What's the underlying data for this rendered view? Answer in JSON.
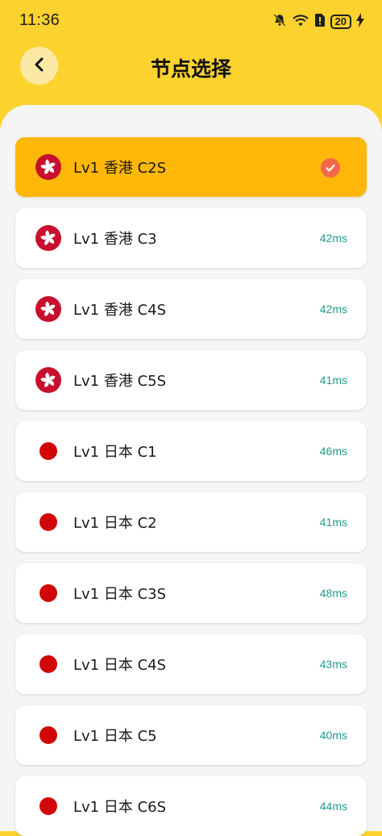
{
  "status_bar": {
    "time": "11:36",
    "battery": "20",
    "icons": [
      "bell-off-icon",
      "wifi-icon",
      "sim-alert-icon",
      "battery-icon",
      "charging-icon"
    ]
  },
  "header": {
    "title": "节点选择",
    "back_icon": "chevron-left-icon"
  },
  "colors": {
    "background": "#FCD22E",
    "selected_card": "#FFB70A",
    "latency_text": "#1E9C8C",
    "check_badge": "#F4684A"
  },
  "nodes": [
    {
      "name": "Lv1 香港 C2S",
      "flag": "hong-kong-flag-icon",
      "latency": "",
      "selected": true
    },
    {
      "name": "Lv1 香港 C3",
      "flag": "hong-kong-flag-icon",
      "latency": "42ms",
      "selected": false
    },
    {
      "name": "Lv1 香港 C4S",
      "flag": "hong-kong-flag-icon",
      "latency": "42ms",
      "selected": false
    },
    {
      "name": "Lv1 香港 C5S",
      "flag": "hong-kong-flag-icon",
      "latency": "41ms",
      "selected": false
    },
    {
      "name": "Lv1 日本 C1",
      "flag": "japan-flag-icon",
      "latency": "46ms",
      "selected": false
    },
    {
      "name": "Lv1 日本 C2",
      "flag": "japan-flag-icon",
      "latency": "41ms",
      "selected": false
    },
    {
      "name": "Lv1 日本 C3S",
      "flag": "japan-flag-icon",
      "latency": "48ms",
      "selected": false
    },
    {
      "name": "Lv1 日本 C4S",
      "flag": "japan-flag-icon",
      "latency": "43ms",
      "selected": false
    },
    {
      "name": "Lv1 日本 C5",
      "flag": "japan-flag-icon",
      "latency": "40ms",
      "selected": false
    },
    {
      "name": "Lv1 日本 C6S",
      "flag": "japan-flag-icon",
      "latency": "44ms",
      "selected": false
    }
  ]
}
